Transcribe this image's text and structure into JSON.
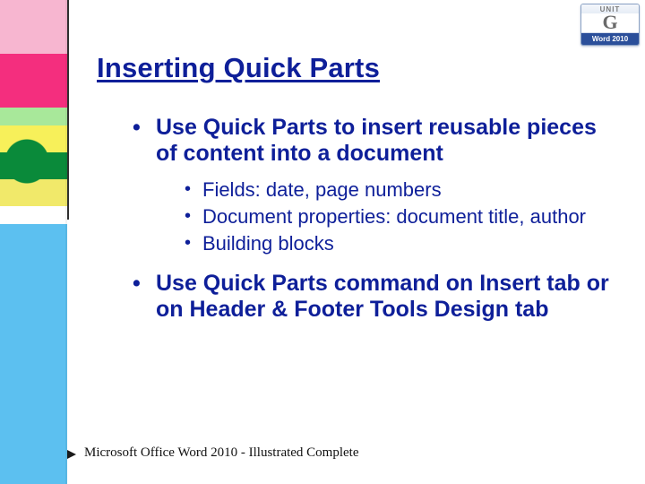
{
  "unit_badge": {
    "label": "UNIT",
    "letter": "G",
    "product": "Word 2010"
  },
  "slide": {
    "title": "Inserting Quick Parts",
    "bullets": [
      {
        "text": "Use Quick Parts to insert reusable pieces of content into a document",
        "sub": [
          "Fields: date, page numbers",
          "Document properties: document title, author",
          "Building blocks"
        ]
      },
      {
        "text": "Use Quick Parts command on Insert tab or on Header & Footer Tools Design tab",
        "sub": []
      }
    ]
  },
  "footer": "Microsoft Office Word 2010 - Illustrated Complete"
}
